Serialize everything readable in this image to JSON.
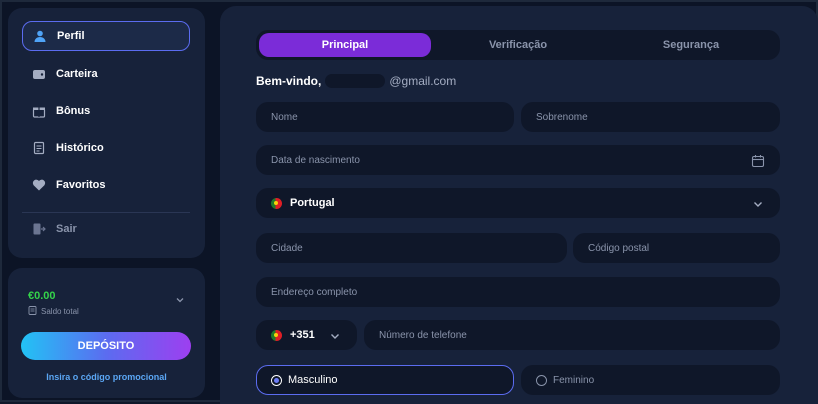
{
  "sidebar": {
    "items": [
      {
        "label": "Perfil",
        "icon": "user-icon"
      },
      {
        "label": "Carteira",
        "icon": "wallet-icon"
      },
      {
        "label": "Bônus",
        "icon": "gift-icon"
      },
      {
        "label": "Histórico",
        "icon": "history-icon"
      },
      {
        "label": "Favoritos",
        "icon": "heart-icon"
      }
    ],
    "logout_label": "Sair",
    "logout_icon": "logout-icon"
  },
  "balance": {
    "amount": "€0.00",
    "label": "Saldo total",
    "deposit_label": "DEPÓSITO",
    "promo_label": "Insira o código promocional"
  },
  "tabs": [
    {
      "label": "Principal",
      "active": true
    },
    {
      "label": "Verificação",
      "active": false
    },
    {
      "label": "Segurança",
      "active": false
    }
  ],
  "welcome": {
    "greeting": "Bem-vindo,",
    "email_suffix": "@gmail.com"
  },
  "form": {
    "first_name_placeholder": "Nome",
    "last_name_placeholder": "Sobrenome",
    "birthdate_placeholder": "Data de nascimento",
    "country_value": "Portugal",
    "city_placeholder": "Cidade",
    "postal_placeholder": "Código postal",
    "address_placeholder": "Endereço completo",
    "phone_code": "+351",
    "phone_placeholder": "Número de telefone",
    "gender_male": "Masculino",
    "gender_female": "Feminino"
  },
  "colors": {
    "accent_purple": "#7b2cd8",
    "balance_green": "#34d34a",
    "link_blue": "#5ba7f5"
  }
}
